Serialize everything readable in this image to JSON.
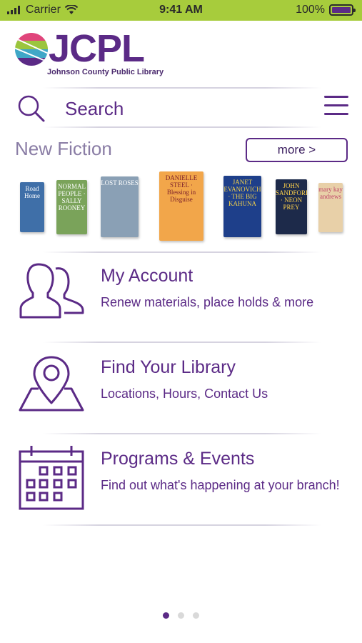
{
  "status_bar": {
    "carrier": "Carrier",
    "time": "9:41 AM",
    "battery": "100%"
  },
  "header": {
    "logo_text": "JCPL",
    "logo_subtitle": "Johnson County Public Library"
  },
  "search": {
    "label": "Search"
  },
  "new_fiction": {
    "title": "New Fiction",
    "more_label": "more >",
    "books": [
      {
        "title": "Road Home",
        "color": "#3f6fa8"
      },
      {
        "title": "NORMAL PEOPLE · SALLY ROONEY",
        "color": "#7aa35a"
      },
      {
        "title": "LOST ROSES",
        "color": "#8aa0b5"
      },
      {
        "title": "DANIELLE STEEL · Blessing in Disguise",
        "color": "#f2a64a"
      },
      {
        "title": "JANET EVANOVICH · THE BIG KAHUNA",
        "color": "#1e3f8a"
      },
      {
        "title": "JOHN SANDFORD · NEON PREY",
        "color": "#1d2a4a"
      },
      {
        "title": "mary kay andrews",
        "color": "#e8d0a8"
      }
    ]
  },
  "menu": [
    {
      "title": "My Account",
      "subtitle": "Renew materials, place holds & more",
      "icon": "people-icon"
    },
    {
      "title": "Find Your Library",
      "subtitle": "Locations, Hours, Contact Us",
      "icon": "map-pin-icon"
    },
    {
      "title": "Programs & Events",
      "subtitle": "Find out what's happening at your branch!",
      "icon": "calendar-icon"
    }
  ],
  "colors": {
    "brand_purple": "#5b2a86",
    "status_bar_green": "#a7cc3c"
  },
  "pager": {
    "pages": 3,
    "active": 1
  }
}
